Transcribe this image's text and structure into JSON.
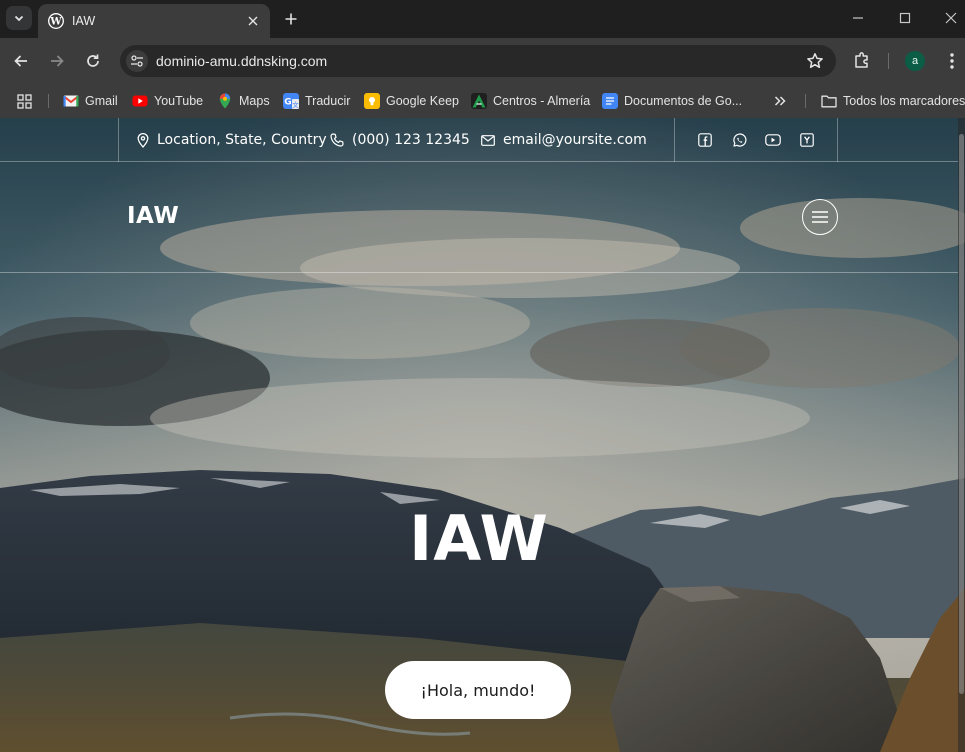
{
  "browser": {
    "tab_title": "IAW",
    "url": "dominio-amu.ddnsking.com",
    "profile_initial": "a",
    "bookmarks": [
      {
        "label": "Gmail",
        "icon": "gmail-icon"
      },
      {
        "label": "YouTube",
        "icon": "youtube-icon"
      },
      {
        "label": "Maps",
        "icon": "maps-icon"
      },
      {
        "label": "Traducir",
        "icon": "translate-icon"
      },
      {
        "label": "Google Keep",
        "icon": "keep-icon"
      },
      {
        "label": "Centros - Almería",
        "icon": "centros-icon"
      },
      {
        "label": "Documentos de Go...",
        "icon": "docs-icon"
      }
    ],
    "all_bookmarks_label": "Todos los marcadores"
  },
  "site": {
    "topbar": {
      "location": "Location, State, Country",
      "phone": "(000) 123 12345",
      "email": "email@yoursite.com",
      "social": [
        "facebook-icon",
        "whatsapp-icon",
        "youtube-icon",
        "yelp-icon"
      ]
    },
    "title": "IAW",
    "hero": {
      "title": "IAW",
      "button_label": "¡Hola, mundo!"
    }
  },
  "colors": {
    "chrome_dark": "#1f1f1f",
    "chrome_toolbar": "#3c3c3c",
    "omnibox": "#282828",
    "avatar": "#0b5d46",
    "hero_text": "#ffffff",
    "button_bg": "#ffffff"
  }
}
